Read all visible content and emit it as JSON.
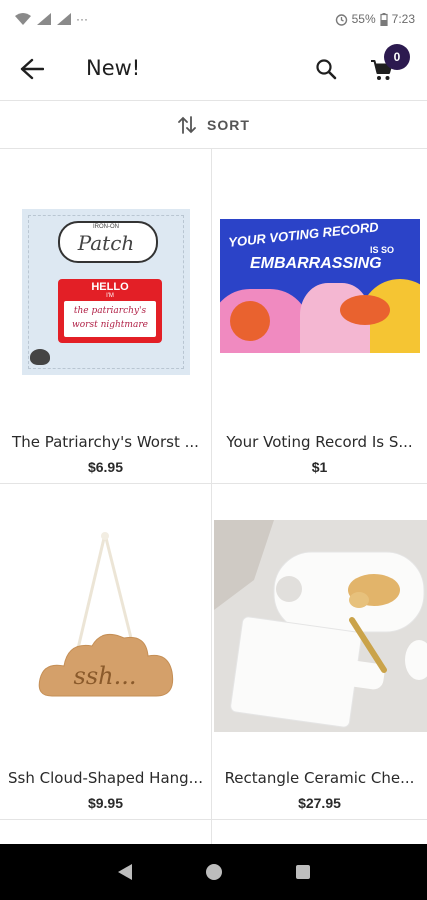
{
  "status_bar": {
    "dots": "···",
    "battery": "55%",
    "time": "7:23"
  },
  "header": {
    "title": "New!",
    "cart_count": "0"
  },
  "sort": {
    "label": "SORT"
  },
  "products": [
    {
      "name": "The Patriarchy's Worst ...",
      "price": "$6.95",
      "art": {
        "badge_top": "IRON-ON",
        "badge_main": "Patch",
        "hello": "HELLO",
        "im": "I'M",
        "line1": "the patriarchy's",
        "line2": "worst nightmare"
      }
    },
    {
      "name": "Your Voting Record Is S...",
      "price": "$1",
      "art": {
        "line1": "YOUR VOTING RECORD",
        "line2": "IS SO",
        "line3": "EMBARRASSING"
      }
    },
    {
      "name": "Ssh Cloud-Shaped Hang...",
      "price": "$9.95",
      "art": {
        "text": "ssh..."
      }
    },
    {
      "name": "Rectangle Ceramic Che...",
      "price": "$27.95"
    }
  ],
  "colors": {
    "badge_bg": "#2c1a4f",
    "accent_pink": "#f08ac0",
    "card_blue": "#2b43c8",
    "cloud_wood": "#d4a06a"
  },
  "icons": {
    "back": "arrow-left-icon",
    "search": "search-icon",
    "cart": "cart-icon",
    "sort": "sort-arrows-icon"
  }
}
